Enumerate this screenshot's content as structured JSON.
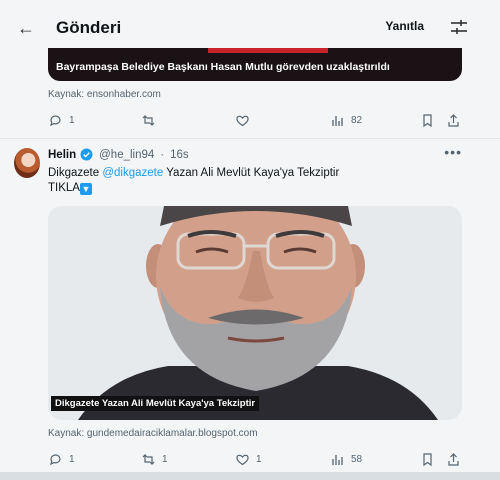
{
  "header": {
    "title": "Gönderi",
    "reply_label": "Yanıtla"
  },
  "previous_post": {
    "card_caption": "Bayrampaşa Belediye Başkanı Hasan Mutlu görevden uzaklaştırıldı",
    "source": "Kaynak: ensonhaber.com",
    "replies": "1",
    "views": "82"
  },
  "post": {
    "author": "Helin",
    "handle": "@he_lin94",
    "time": "16s",
    "text_prefix": "Dikgazete ",
    "mention": "@dikgazete",
    "text_rest": " Yazan Ali Mevlüt Kaya'ya Tekziptir",
    "text_line2": "TIKLA",
    "image_caption": "Dikgazete Yazan Ali Mevlüt Kaya'ya Tekziptir",
    "source": "Kaynak: gundemedairaciklamalar.blogspot.com",
    "replies": "1",
    "reposts": "1",
    "likes": "1",
    "views": "58"
  },
  "icons": {
    "back": "arrow-left-icon",
    "settings": "sliders-icon",
    "reply": "reply-icon",
    "repost": "repost-icon",
    "like": "heart-icon",
    "views": "views-icon",
    "bookmark": "bookmark-icon",
    "share": "share-icon",
    "verified": "verified-badge-icon",
    "more": "more-icon"
  },
  "colors": {
    "accent": "#1d9bf0",
    "text": "#0f1419",
    "muted": "#536471",
    "background": "#f4f5f6"
  }
}
